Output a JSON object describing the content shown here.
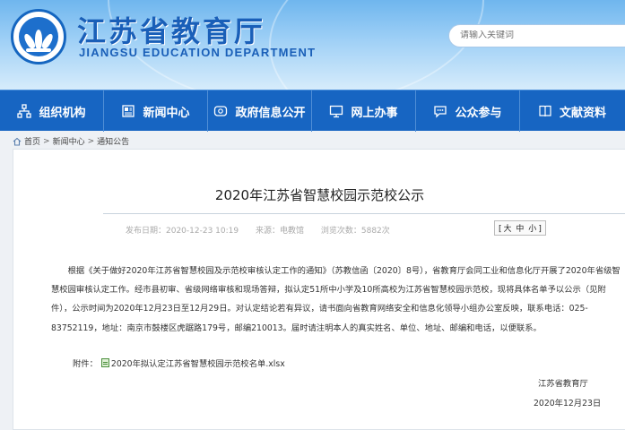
{
  "header": {
    "title": "江苏省教育厅",
    "subtitle": "JIANGSU EDUCATION DEPARTMENT",
    "search_placeholder": "请输入关键词"
  },
  "nav": [
    {
      "label": "组织机构",
      "icon": "org-chart-icon"
    },
    {
      "label": "新闻中心",
      "icon": "news-icon"
    },
    {
      "label": "政府信息公开",
      "icon": "gov-info-icon"
    },
    {
      "label": "网上办事",
      "icon": "monitor-icon"
    },
    {
      "label": "公众参与",
      "icon": "chat-icon"
    },
    {
      "label": "文献资料",
      "icon": "book-icon"
    }
  ],
  "breadcrumb": {
    "home": "首页",
    "sep": ">",
    "news": "新闻中心",
    "notice": "通知公告"
  },
  "article": {
    "title": "2020年江苏省智慧校园示范校公示",
    "published": "发布日期：2020-12-23 10:19",
    "source": "来源：电教馆",
    "views": "浏览次数：5882次",
    "font_bracket_open": "[",
    "font_large": "大",
    "font_medium": "中",
    "font_small": "小",
    "font_bracket_close": "]",
    "body": "根据《关于做好2020年江苏省智慧校园及示范校审核认定工作的通知》（苏教信函〔2020〕8号），省教育厅会同工业和信息化厅开展了2020年省级智慧校园审核认定工作。经市县初审、省级网络审核和现场答辩，拟认定51所中小学及10所高校为江苏省智慧校园示范校，现将具体名单予以公示（见附件），公示时间为2020年12月23日至12月29日。对认定结论若有异议，请书面向省教育网络安全和信息化领导小组办公室反映，联系电话：025-83752119，地址：南京市鼓楼区虎踞路179号，邮编210013。届时请注明本人的真实姓名、单位、地址、邮编和电话，以便联系。",
    "attachment_label": "附件：",
    "attachment_file": "2020年拟认定江苏省智慧校园示范校名单.xlsx",
    "sign_org": "江苏省教育厅",
    "sign_date": "2020年12月23日"
  },
  "colors": {
    "nav_bg": "#1765c2",
    "brand_blue": "#1a5fb8"
  }
}
